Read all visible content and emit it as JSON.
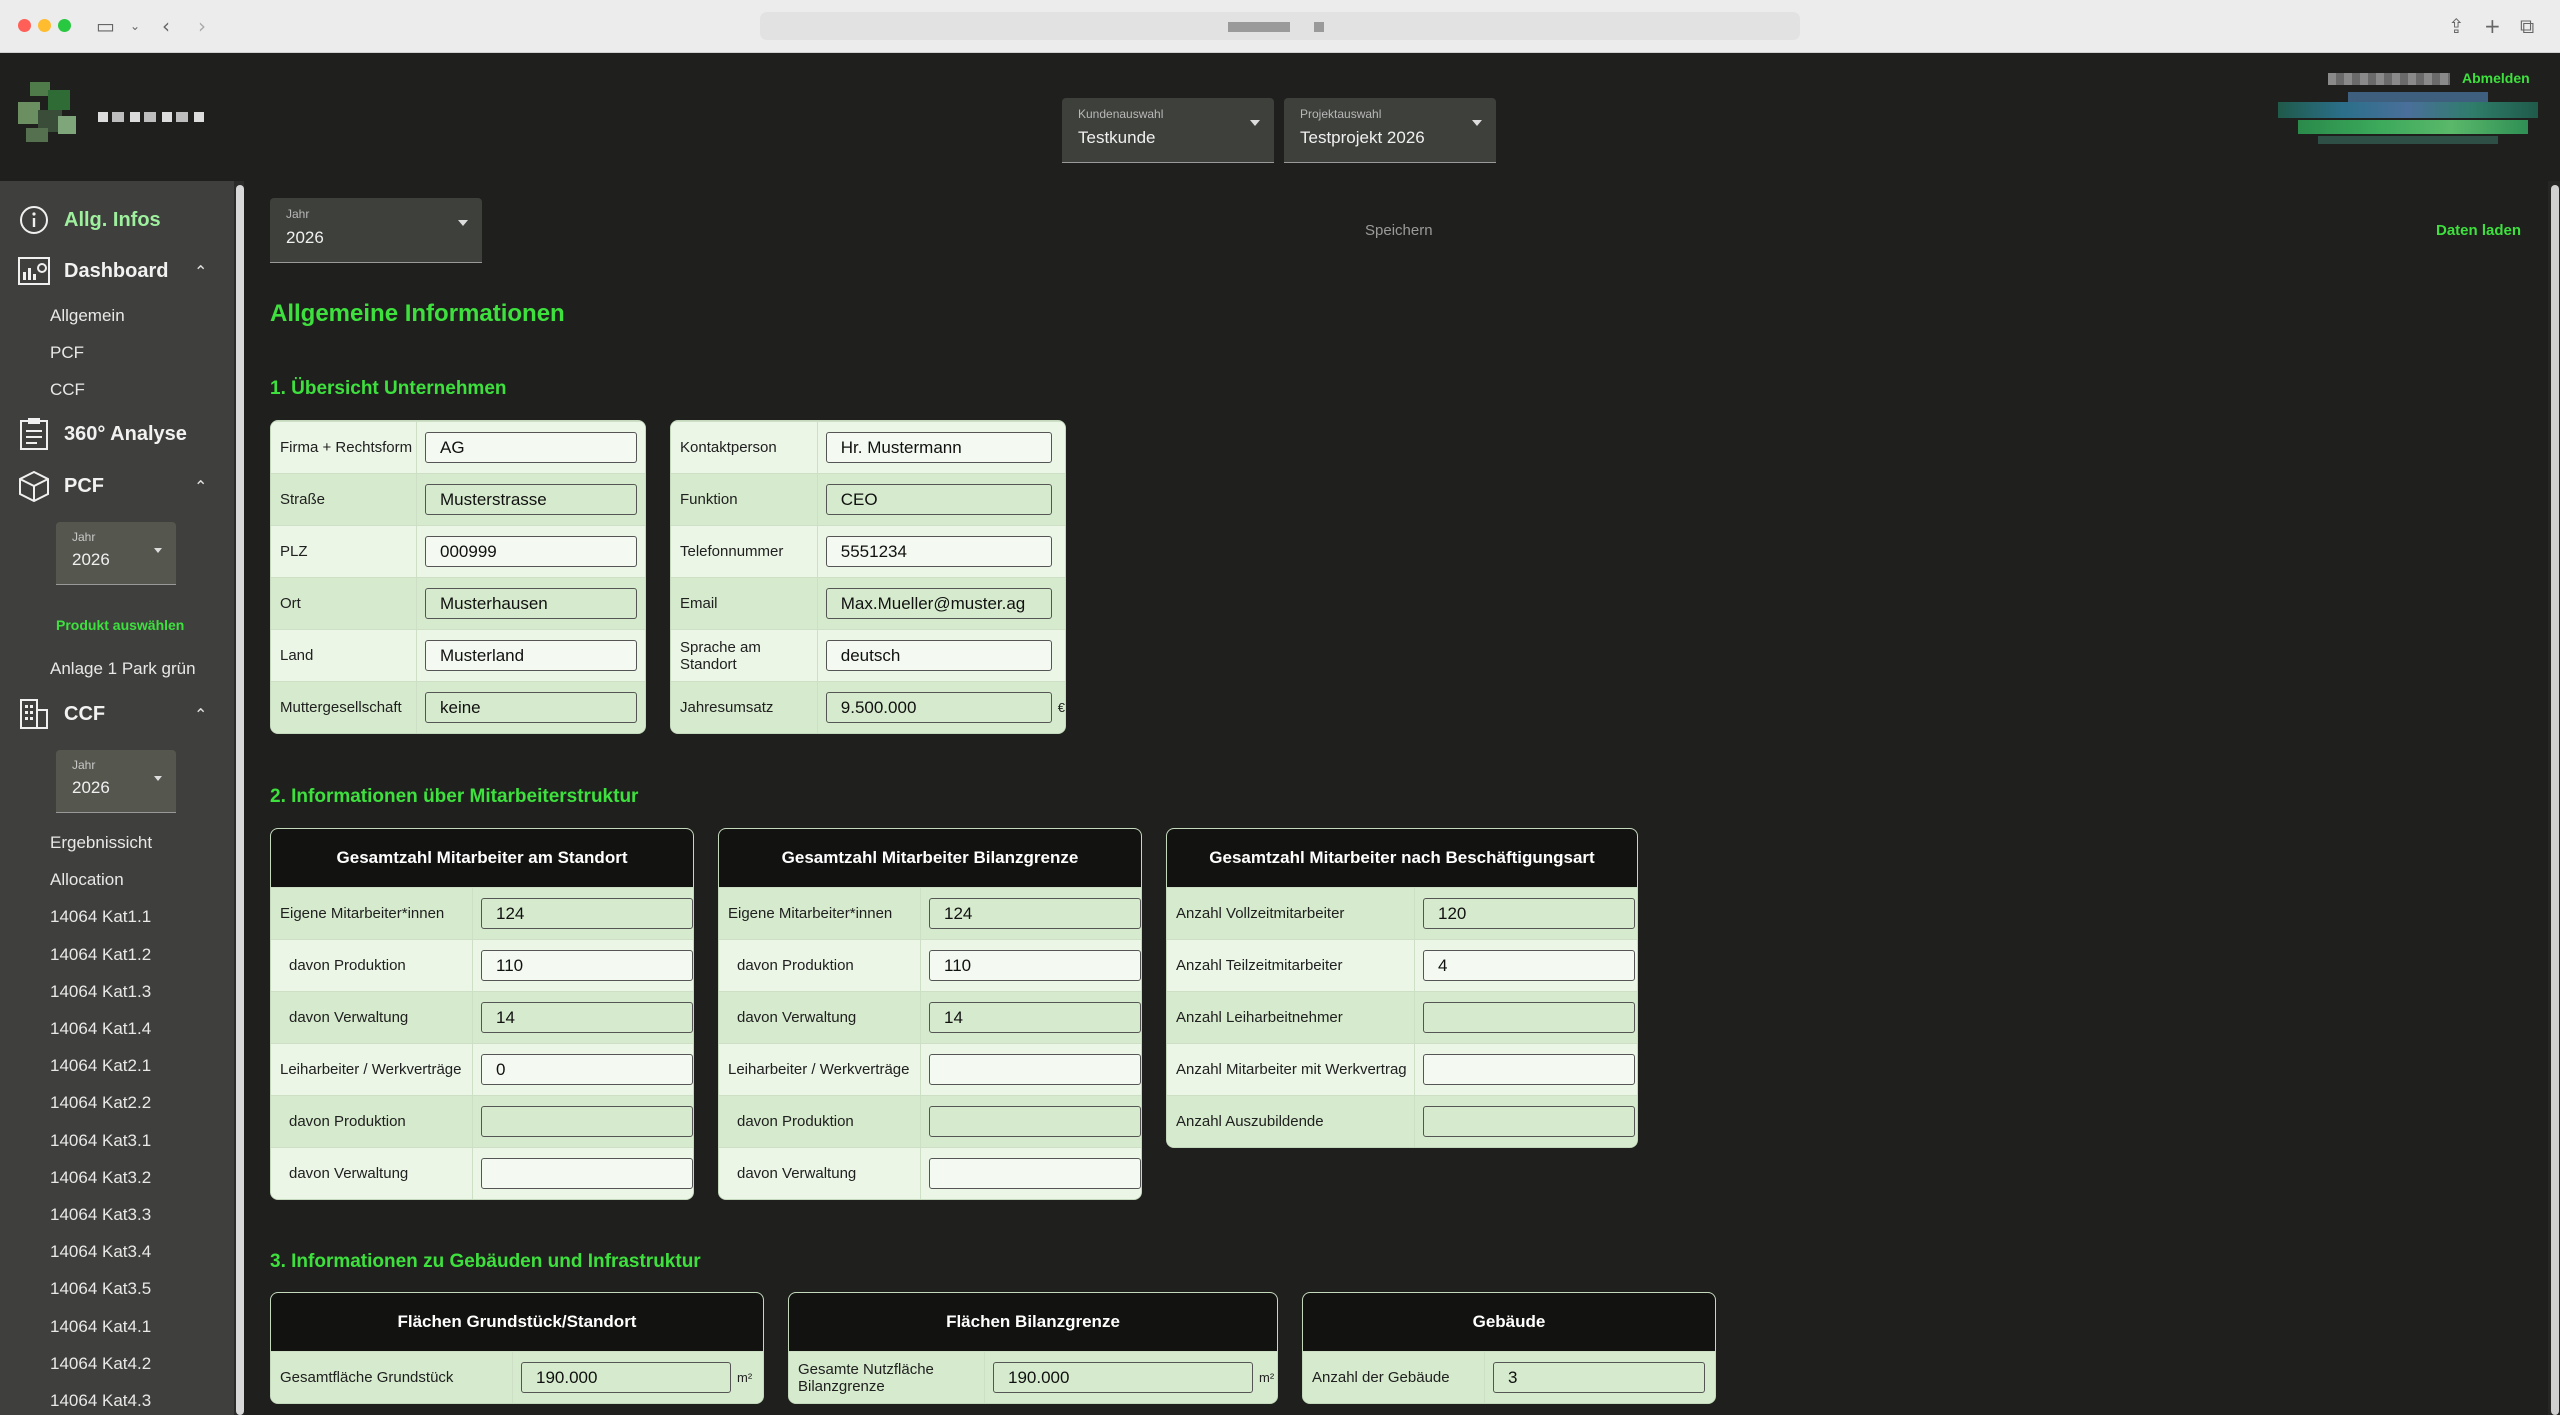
{
  "header": {
    "kunde": {
      "label": "Kundenauswahl",
      "value": "Testkunde"
    },
    "projekt": {
      "label": "Projektauswahl",
      "value": "Testprojekt 2026"
    },
    "logout": "Abmelden"
  },
  "sidebar": {
    "allg_infos": "Allg. Infos",
    "dashboard": "Dashboard",
    "dashboard_items": [
      "Allgemein",
      "PCF",
      "CCF"
    ],
    "analyse": "360° Analyse",
    "pcf": "PCF",
    "pcf_year": {
      "label": "Jahr",
      "value": "2026"
    },
    "produkt_auswaehlen": "Produkt auswählen",
    "produkt": "Anlage 1 Park grün",
    "ccf": "CCF",
    "ccf_year": {
      "label": "Jahr",
      "value": "2026"
    },
    "ccf_items": [
      "Ergebnissicht",
      "Allocation",
      "14064 Kat1.1",
      "14064 Kat1.2",
      "14064 Kat1.3",
      "14064 Kat1.4",
      "14064 Kat2.1",
      "14064 Kat2.2",
      "14064 Kat3.1",
      "14064 Kat3.2",
      "14064 Kat3.3",
      "14064 Kat3.4",
      "14064 Kat3.5",
      "14064 Kat4.1",
      "14064 Kat4.2",
      "14064 Kat4.3"
    ]
  },
  "main": {
    "year": {
      "label": "Jahr",
      "value": "2026"
    },
    "save": "Speichern",
    "load": "Daten laden",
    "title": "Allgemeine Informationen",
    "section1": "1. Übersicht Unternehmen",
    "company": [
      {
        "label": "Firma + Rechtsform",
        "value": "AG"
      },
      {
        "label": "Straße",
        "value": "Musterstrasse"
      },
      {
        "label": "PLZ",
        "value": "000999"
      },
      {
        "label": "Ort",
        "value": "Musterhausen"
      },
      {
        "label": "Land",
        "value": "Musterland"
      },
      {
        "label": "Muttergesellschaft",
        "value": "keine"
      }
    ],
    "contact": [
      {
        "label": "Kontaktperson",
        "value": "Hr. Mustermann"
      },
      {
        "label": "Funktion",
        "value": "CEO"
      },
      {
        "label": "Telefonnummer",
        "value": "5551234"
      },
      {
        "label": "Email",
        "value": "Max.Mueller@muster.ag"
      },
      {
        "label": "Sprache am Standort",
        "value": "deutsch"
      },
      {
        "label": "Jahresumsatz",
        "value": "9.500.000",
        "unit": "€"
      }
    ],
    "section2": "2. Informationen über Mitarbeiterstruktur",
    "staff_site": {
      "title": "Gesamtzahl Mitarbeiter am Standort",
      "rows": [
        {
          "label": "Eigene Mitarbeiter*innen",
          "value": "124"
        },
        {
          "label": "davon Produktion",
          "value": "110"
        },
        {
          "label": "davon Verwaltung",
          "value": "14"
        },
        {
          "label": "Leiharbeiter / Werkverträge",
          "value": "0"
        },
        {
          "label": "davon Produktion",
          "value": ""
        },
        {
          "label": "davon Verwaltung",
          "value": ""
        }
      ]
    },
    "staff_boundary": {
      "title": "Gesamtzahl Mitarbeiter Bilanzgrenze",
      "rows": [
        {
          "label": "Eigene Mitarbeiter*innen",
          "value": "124"
        },
        {
          "label": "davon Produktion",
          "value": "110"
        },
        {
          "label": "davon Verwaltung",
          "value": "14"
        },
        {
          "label": "Leiharbeiter / Werkverträge",
          "value": ""
        },
        {
          "label": "davon Produktion",
          "value": ""
        },
        {
          "label": "davon Verwaltung",
          "value": ""
        }
      ]
    },
    "staff_type": {
      "title": "Gesamtzahl Mitarbeiter nach Beschäftigungsart",
      "rows": [
        {
          "label": "Anzahl Vollzeitmitarbeiter",
          "value": "120"
        },
        {
          "label": "Anzahl Teilzeitmitarbeiter",
          "value": "4"
        },
        {
          "label": "Anzahl Leiharbeitnehmer",
          "value": ""
        },
        {
          "label": "Anzahl Mitarbeiter mit Werkvertrag",
          "value": ""
        },
        {
          "label": "Anzahl Auszubildende",
          "value": ""
        }
      ]
    },
    "section3": "3. Informationen zu Gebäuden und Infrastruktur",
    "area_site": {
      "title": "Flächen Grundstück/Standort",
      "label": "Gesamtfläche Grundstück",
      "value": "190.000",
      "unit": "m²"
    },
    "area_boundary": {
      "title": "Flächen Bilanzgrenze",
      "label": "Gesamte Nutzfläche Bilanzgrenze",
      "value": "190.000",
      "unit": "m²"
    },
    "buildings": {
      "title": "Gebäude",
      "label": "Anzahl der Gebäude",
      "value": "3"
    }
  }
}
